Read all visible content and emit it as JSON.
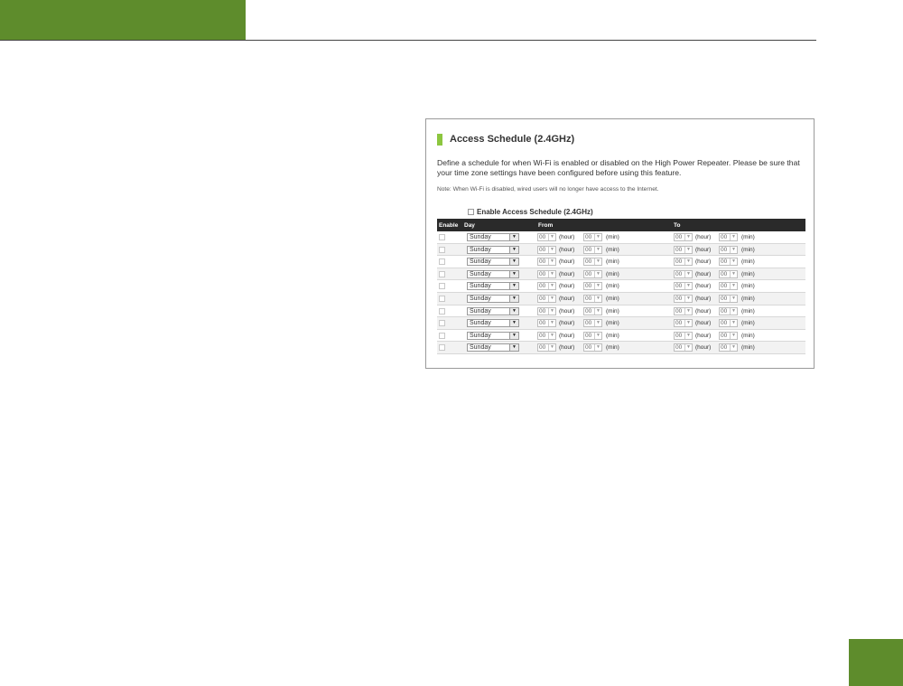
{
  "panel": {
    "title": "Access Schedule (2.4GHz)",
    "description": "Define a schedule for when Wi-Fi is enabled or disabled on the High Power Repeater. Please be sure that your time zone settings have been configured before using this feature.",
    "note": "Note: When Wi-Fi is disabled, wired users will no longer have access to the Internet.",
    "enable_all_label": "Enable Access Schedule (2.4GHz)"
  },
  "table": {
    "headers": {
      "enable": "Enable",
      "day": "Day",
      "from": "From",
      "to": "To"
    },
    "unit_hour": "(hour)",
    "unit_min": "(min)",
    "rows": [
      {
        "day": "Sunday",
        "from_hour": "00",
        "from_min": "00",
        "to_hour": "00",
        "to_min": "00"
      },
      {
        "day": "Sunday",
        "from_hour": "00",
        "from_min": "00",
        "to_hour": "00",
        "to_min": "00"
      },
      {
        "day": "Sunday",
        "from_hour": "00",
        "from_min": "00",
        "to_hour": "00",
        "to_min": "00"
      },
      {
        "day": "Sunday",
        "from_hour": "00",
        "from_min": "00",
        "to_hour": "00",
        "to_min": "00"
      },
      {
        "day": "Sunday",
        "from_hour": "00",
        "from_min": "00",
        "to_hour": "00",
        "to_min": "00"
      },
      {
        "day": "Sunday",
        "from_hour": "00",
        "from_min": "00",
        "to_hour": "00",
        "to_min": "00"
      },
      {
        "day": "Sunday",
        "from_hour": "00",
        "from_min": "00",
        "to_hour": "00",
        "to_min": "00"
      },
      {
        "day": "Sunday",
        "from_hour": "00",
        "from_min": "00",
        "to_hour": "00",
        "to_min": "00"
      },
      {
        "day": "Sunday",
        "from_hour": "00",
        "from_min": "00",
        "to_hour": "00",
        "to_min": "00"
      },
      {
        "day": "Sunday",
        "from_hour": "00",
        "from_min": "00",
        "to_hour": "00",
        "to_min": "00"
      }
    ]
  },
  "colors": {
    "brand_green": "#5e8c2c",
    "accent_green": "#8cc63f",
    "table_header": "#2a2a2a"
  },
  "icons": {
    "dropdown": "triangle-down"
  }
}
